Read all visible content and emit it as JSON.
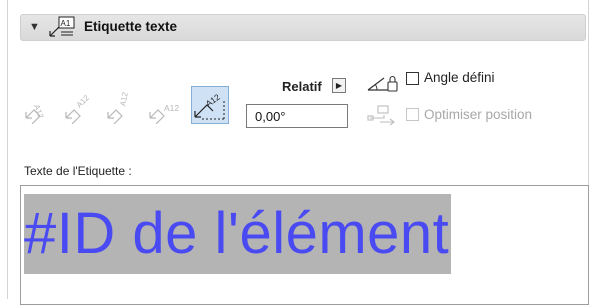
{
  "panel": {
    "title": "Etiquette texte",
    "collapse_icon": "triangle-down",
    "header_icon": "label-text-icon"
  },
  "tools": {
    "items": [
      {
        "name": "label-orientation-1-icon",
        "label": "A12",
        "active": false
      },
      {
        "name": "label-orientation-2-icon",
        "label": "A12",
        "active": false
      },
      {
        "name": "label-orientation-3-icon",
        "label": "A12",
        "active": false
      },
      {
        "name": "label-orientation-4-icon",
        "label": "A12",
        "active": false
      },
      {
        "name": "label-orientation-5-icon",
        "label": "A12",
        "active": true
      }
    ]
  },
  "angle": {
    "relatif_label": "Relatif",
    "value": "0,00°"
  },
  "options": {
    "angle_defini": {
      "label": "Angle défini",
      "checked": false,
      "enabled": true
    },
    "optimiser": {
      "label": "Optimiser position",
      "checked": false,
      "enabled": false
    }
  },
  "text_section": {
    "label": "Texte de l'Etiquette :",
    "content": "#ID de l'élément"
  },
  "colors": {
    "header_bg": "#dcdcdc",
    "active_tool_bg": "#cfe1f5",
    "text_color": "#4a4af2",
    "text_highlight": "#b4b4b4",
    "disabled_text": "#a8a8a8"
  }
}
